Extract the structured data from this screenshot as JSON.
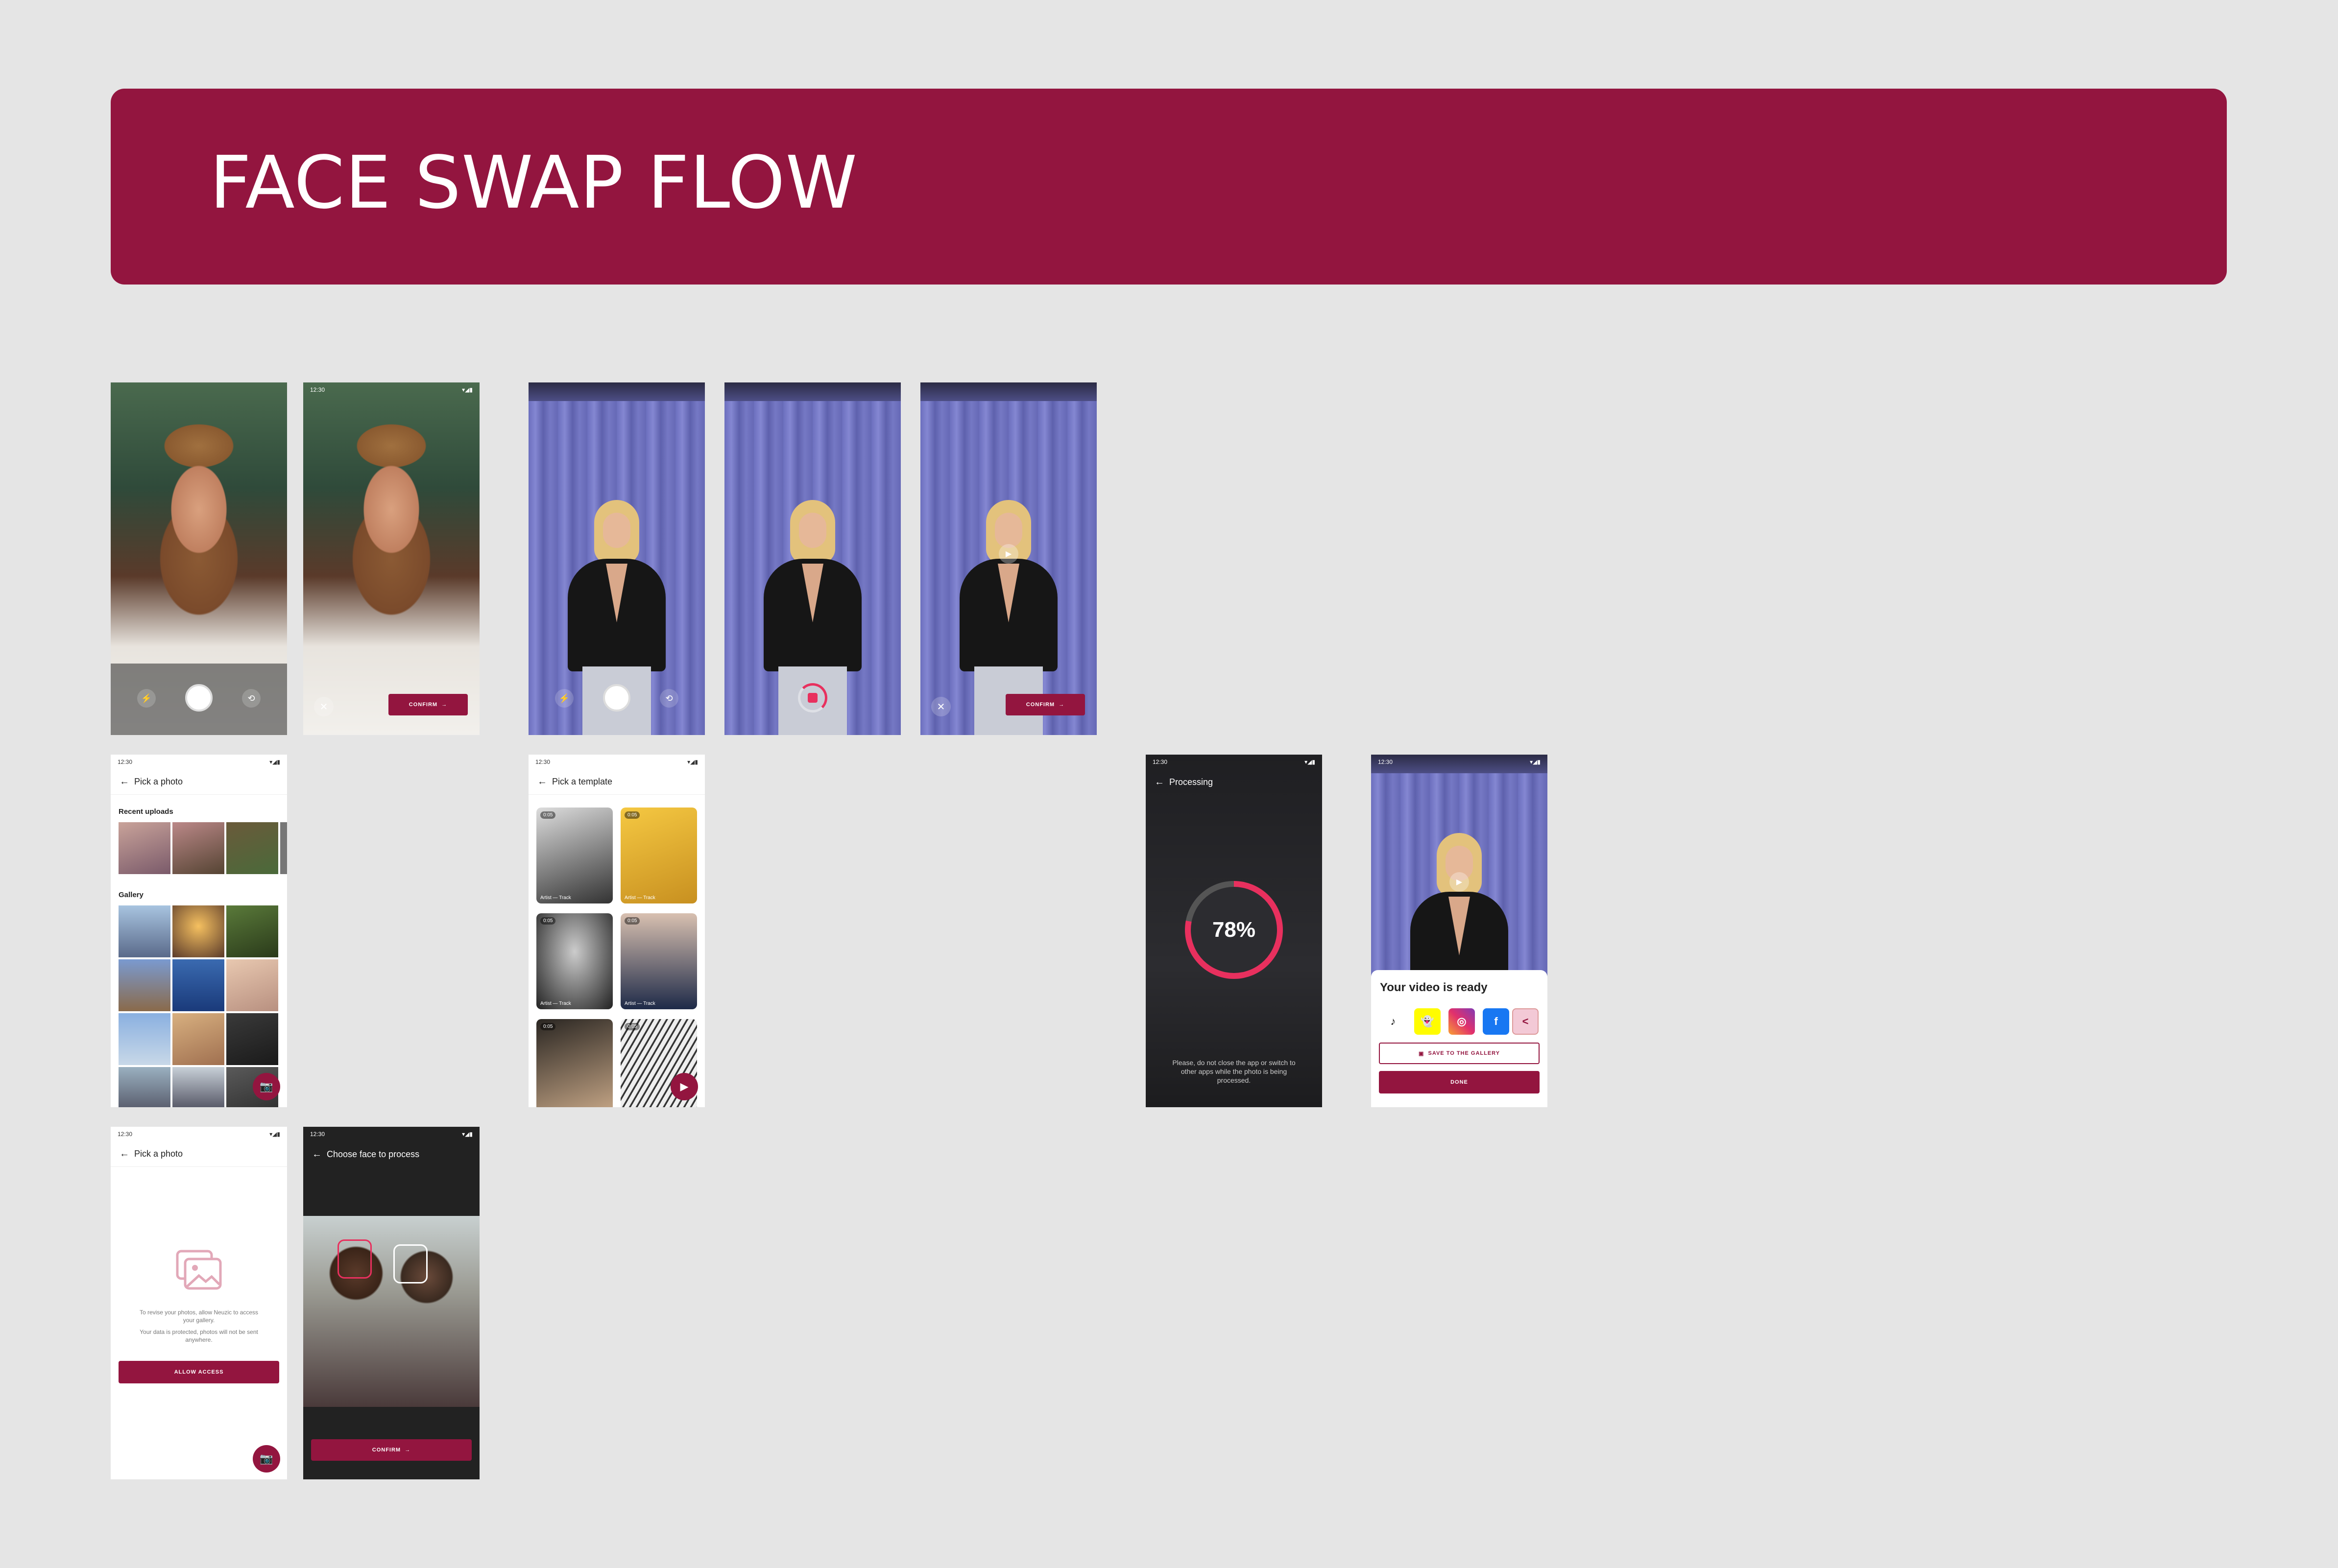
{
  "banner": {
    "title": "FACE SWAP FLOW"
  },
  "status_time": "12:30",
  "status_icons": "▾◢▮",
  "icons": {
    "flash": "flash-icon",
    "flip": "flip-camera-icon",
    "close": "close-icon",
    "arrow": "arrow-right-icon",
    "back": "back-arrow-icon",
    "camera": "camera-icon",
    "video": "video-icon",
    "play": "play-icon",
    "share": "share-icon",
    "gallery": "gallery-icon",
    "tiktok": "tiktok-icon",
    "snapchat": "snapchat-icon",
    "instagram": "instagram-icon",
    "facebook": "facebook-icon",
    "photos": "photos-icon"
  },
  "glyphs": {
    "flash": "⚡",
    "flip": "⟲",
    "close": "✕",
    "arrow": "→",
    "back": "←",
    "camera": "📷",
    "video": "▶",
    "play": "▶",
    "share": "<",
    "tiktok": "♪",
    "snapchat": "👻",
    "instagram": "◎",
    "facebook": "f",
    "save": "▣"
  },
  "camera_confirm": "CONFIRM",
  "pick_photo": {
    "title": "Pick a photo",
    "recent_label": "Recent uploads",
    "gallery_label": "Gallery"
  },
  "pick_template": {
    "title": "Pick a template",
    "cards": [
      {
        "duration": "0:05",
        "meta": "Artist — Track"
      },
      {
        "duration": "0:05",
        "meta": "Artist — Track"
      },
      {
        "duration": "0:05",
        "meta": "Artist — Track"
      },
      {
        "duration": "0:05",
        "meta": "Artist — Track"
      },
      {
        "duration": "0:05",
        "meta": ""
      },
      {
        "duration": "0:05",
        "meta": ""
      }
    ]
  },
  "processing": {
    "title": "Processing",
    "percent_text": "78%",
    "progress": 0.78,
    "note": "Please, do not close the app or switch to other apps while the photo is being processed."
  },
  "ready": {
    "title": "Your video is ready",
    "save_label": "SAVE TO THE GALLERY",
    "done_label": "DONE"
  },
  "permission": {
    "title": "Pick a photo",
    "text1": "To revise your photos, allow Neuzic to access your gallery.",
    "text2": "Your data is protected, photos will not be sent anywhere.",
    "allow_label": "ALLOW ACCESS"
  },
  "choose_face": {
    "title": "Choose face to process",
    "confirm_label": "CONFIRM"
  },
  "colors": {
    "brand": "#93153f",
    "accent_ring": "#e8305e"
  }
}
